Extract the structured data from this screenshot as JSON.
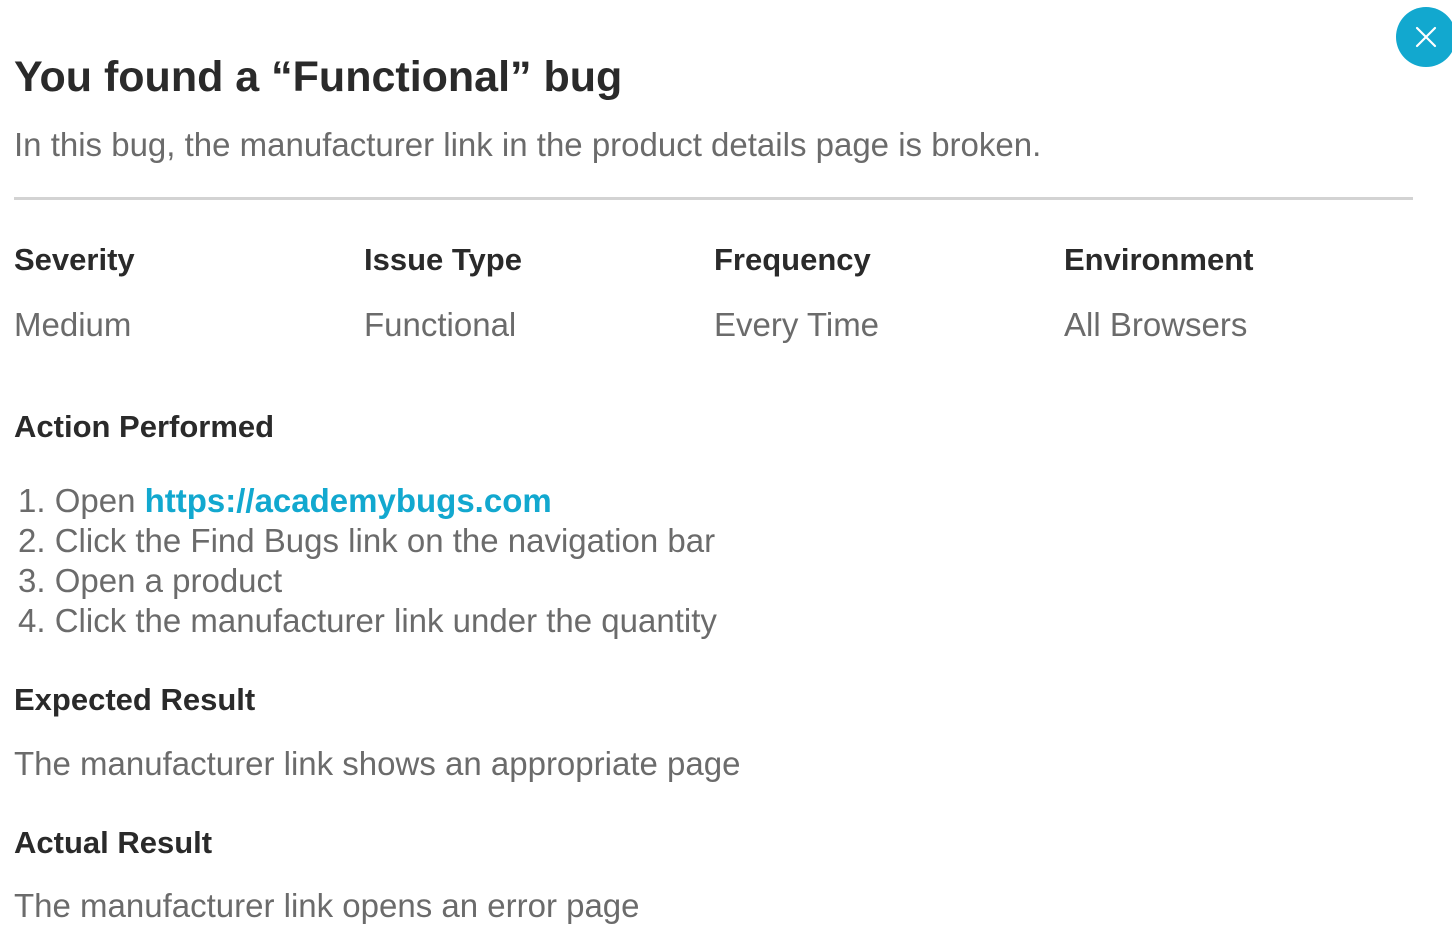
{
  "header": {
    "title": "You found a “Functional” bug",
    "subtitle": "In this bug, the manufacturer link in the product details page is broken."
  },
  "close_button": {
    "icon": "close-icon",
    "color": "#12a8cf"
  },
  "meta": [
    {
      "label": "Severity",
      "value": "Medium"
    },
    {
      "label": "Issue Type",
      "value": "Functional"
    },
    {
      "label": "Frequency",
      "value": "Every Time"
    },
    {
      "label": "Environment",
      "value": "All Browsers"
    }
  ],
  "action_performed": {
    "heading": "Action Performed",
    "steps": [
      {
        "number": "1.",
        "prefix": "Open ",
        "link": "https://academybugs.com"
      },
      {
        "number": "2.",
        "text": "Click the Find Bugs link on the navigation bar"
      },
      {
        "number": "3.",
        "text": "Open a product"
      },
      {
        "number": "4.",
        "text": "Click the manufacturer link under the quantity"
      }
    ]
  },
  "expected_result": {
    "heading": "Expected Result",
    "text": "The manufacturer link shows an appropriate page"
  },
  "actual_result": {
    "heading": "Actual Result",
    "text": "The manufacturer link opens an error page"
  },
  "colors": {
    "accent": "#12a8cf",
    "heading": "#2a2a2a",
    "body": "#6b6b6b",
    "divider": "#d3d3d3"
  }
}
